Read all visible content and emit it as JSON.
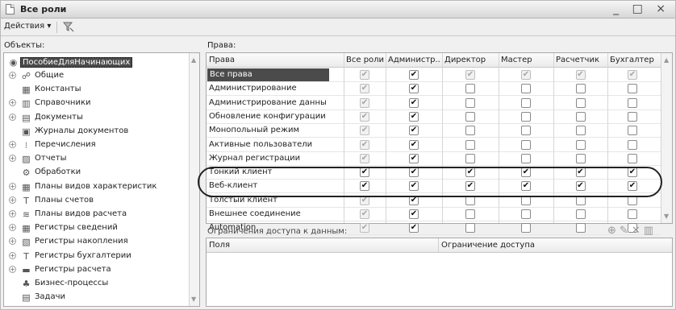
{
  "window": {
    "title": "Все роли",
    "controls": "_ □ ×"
  },
  "toolbar": {
    "actions_label": "Действия ▾",
    "filter_icon": "filter-icon"
  },
  "objects_label": "Объекты:",
  "rights_label": "Права:",
  "tree": {
    "root": "ПособиеДляНачинающих",
    "items": [
      {
        "label": "Общие",
        "icon": "☍",
        "expandable": true
      },
      {
        "label": "Константы",
        "icon": "▦",
        "expandable": false
      },
      {
        "label": "Справочники",
        "icon": "▥",
        "expandable": true
      },
      {
        "label": "Документы",
        "icon": "▤",
        "expandable": true
      },
      {
        "label": "Журналы документов",
        "icon": "▣",
        "expandable": false
      },
      {
        "label": "Перечисления",
        "icon": "⁝",
        "expandable": true
      },
      {
        "label": "Отчеты",
        "icon": "▨",
        "expandable": true
      },
      {
        "label": "Обработки",
        "icon": "⚙",
        "expandable": false
      },
      {
        "label": "Планы видов характеристик",
        "icon": "▦",
        "expandable": true
      },
      {
        "label": "Планы счетов",
        "icon": "T",
        "expandable": true
      },
      {
        "label": "Планы видов расчета",
        "icon": "≋",
        "expandable": true
      },
      {
        "label": "Регистры сведений",
        "icon": "▦",
        "expandable": true
      },
      {
        "label": "Регистры накопления",
        "icon": "▧",
        "expandable": true
      },
      {
        "label": "Регистры бухгалтерии",
        "icon": "T",
        "expandable": true
      },
      {
        "label": "Регистры расчета",
        "icon": "▬",
        "expandable": true
      },
      {
        "label": "Бизнес-процессы",
        "icon": "♣",
        "expandable": false
      },
      {
        "label": "Задачи",
        "icon": "▤",
        "expandable": false
      }
    ]
  },
  "rights_grid": {
    "columns": [
      "Права",
      "Все роли",
      "Администр...",
      "Директор",
      "Мастер",
      "Расчетчик",
      "Бухгалтер"
    ],
    "rows": [
      {
        "name": "Все права",
        "values": [
          "d",
          "c",
          "d",
          "d",
          "d",
          "d"
        ]
      },
      {
        "name": "Администрирование",
        "values": [
          "d",
          "c",
          "",
          "",
          "",
          ""
        ]
      },
      {
        "name": "Администрирование данных",
        "values": [
          "d",
          "c",
          "",
          "",
          "",
          ""
        ]
      },
      {
        "name": "Обновление конфигурации б...",
        "values": [
          "d",
          "c",
          "",
          "",
          "",
          ""
        ]
      },
      {
        "name": "Монопольный режим",
        "values": [
          "d",
          "c",
          "",
          "",
          "",
          ""
        ]
      },
      {
        "name": "Активные пользователи",
        "values": [
          "d",
          "c",
          "",
          "",
          "",
          ""
        ]
      },
      {
        "name": "Журнал регистрации",
        "values": [
          "d",
          "c",
          "",
          "",
          "",
          ""
        ]
      },
      {
        "name": "Тонкий клиент",
        "values": [
          "c",
          "c",
          "c",
          "c",
          "c",
          "c"
        ]
      },
      {
        "name": "Веб-клиент",
        "values": [
          "c",
          "c",
          "c",
          "c",
          "c",
          "c"
        ]
      },
      {
        "name": "Толстый клиент",
        "values": [
          "d",
          "c",
          "",
          "",
          "",
          ""
        ]
      },
      {
        "name": "Внешнее соединение",
        "values": [
          "d",
          "c",
          "",
          "",
          "",
          ""
        ]
      },
      {
        "name": "Automation",
        "values": [
          "d",
          "c",
          "",
          "",
          "",
          ""
        ]
      }
    ]
  },
  "restrictions": {
    "label": "Ограничения доступа к данным:",
    "columns": [
      "Поля",
      "Ограничение доступа"
    ]
  }
}
